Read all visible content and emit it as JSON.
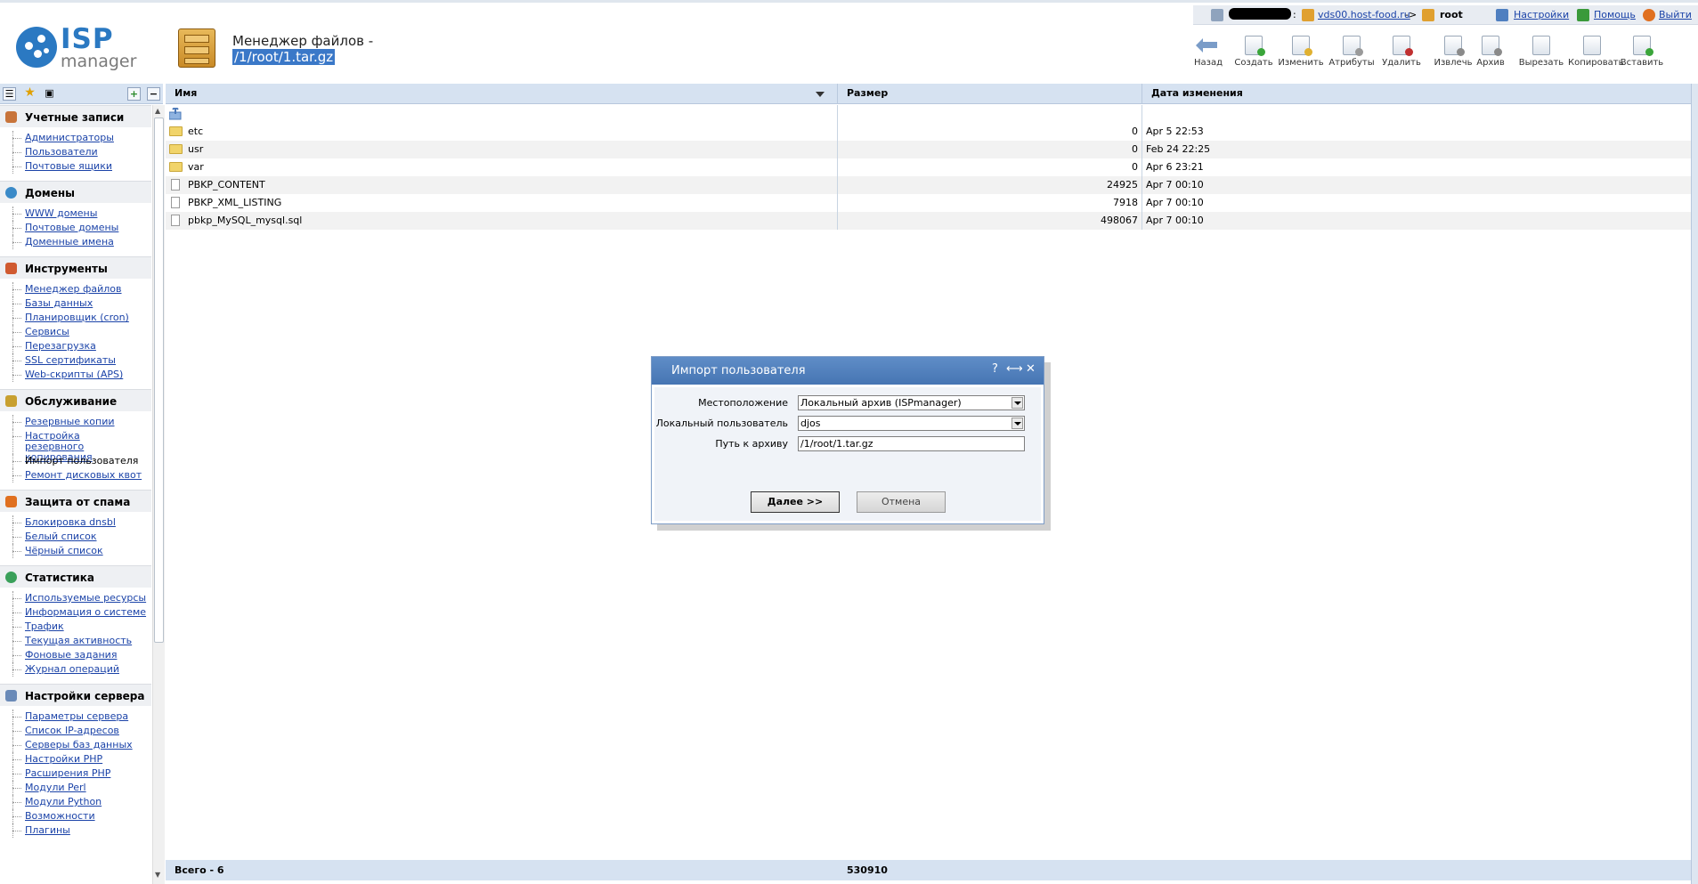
{
  "header": {
    "logo_main": "ISP",
    "logo_sub": "manager",
    "title": "Менеджер файлов -",
    "path": "/1/root/1.tar.gz"
  },
  "userbar": {
    "server_link": "vds00.host-food.ru",
    "arrow": "->",
    "user": "root",
    "settings": "Настройки",
    "help": "Помощь",
    "logout": "Выйти"
  },
  "toolbar": [
    {
      "label": "Назад",
      "icon": "back-arrow-icon"
    },
    {
      "label": "Создать",
      "icon": "create-file-icon"
    },
    {
      "label": "Изменить",
      "icon": "edit-file-icon"
    },
    {
      "label": "Атрибуты",
      "icon": "attributes-icon"
    },
    {
      "label": "Удалить",
      "icon": "delete-icon"
    },
    {
      "label": "Извлечь",
      "icon": "extract-icon"
    },
    {
      "label": "Архив",
      "icon": "archive-icon"
    },
    {
      "label": "Вырезать",
      "icon": "cut-icon"
    },
    {
      "label": "Копировать",
      "icon": "copy-icon"
    },
    {
      "label": "Вставить",
      "icon": "paste-icon"
    }
  ],
  "sidebar": {
    "groups": [
      {
        "title": "Учетные записи",
        "items": [
          "Администраторы",
          "Пользователи",
          "Почтовые ящики"
        ]
      },
      {
        "title": "Домены",
        "items": [
          "WWW домены",
          "Почтовые домены",
          "Доменные имена"
        ]
      },
      {
        "title": "Инструменты",
        "items": [
          "Менеджер файлов",
          "Базы данных",
          "Планировщик (cron)",
          "Сервисы",
          "Перезагрузка",
          "SSL сертификаты",
          "Web-скрипты (APS)"
        ]
      },
      {
        "title": "Обслуживание",
        "items": [
          "Резервные копии",
          "Настройка резервного копирования",
          "Импорт пользователя",
          "Ремонт дисковых квот"
        ]
      },
      {
        "title": "Защита от спама",
        "items": [
          "Блокировка dnsbl",
          "Белый список",
          "Чёрный список"
        ]
      },
      {
        "title": "Статистика",
        "items": [
          "Используемые ресурсы",
          "Информация о системе",
          "Трафик",
          "Текущая активность",
          "Фоновые задания",
          "Журнал операций"
        ]
      },
      {
        "title": "Настройки сервера",
        "items": [
          "Параметры сервера",
          "Список IP-адресов",
          "Серверы баз данных",
          "Настройки PHP",
          "Расширения PHP",
          "Модули Perl",
          "Модули Python",
          "Возможности",
          "Плагины"
        ]
      }
    ]
  },
  "table": {
    "columns": [
      "Имя",
      "Размер",
      "Дата изменения"
    ],
    "rows": [
      {
        "name": "etc",
        "type": "folder",
        "size": "0",
        "date": "Apr 5 22:53"
      },
      {
        "name": "usr",
        "type": "folder",
        "size": "0",
        "date": "Feb 24 22:25"
      },
      {
        "name": "var",
        "type": "folder",
        "size": "0",
        "date": "Apr 6 23:21"
      },
      {
        "name": "PBKP_CONTENT",
        "type": "file",
        "size": "24925",
        "date": "Apr 7 00:10"
      },
      {
        "name": "PBKP_XML_LISTING",
        "type": "file",
        "size": "7918",
        "date": "Apr 7 00:10"
      },
      {
        "name": "pbkp_MySQL_mysql.sql",
        "type": "file",
        "size": "498067",
        "date": "Apr 7 00:10"
      }
    ],
    "footer_total": "Всего - 6",
    "footer_size": "530910"
  },
  "dialog": {
    "title": "Импорт пользователя",
    "help": "?",
    "expand": "⟷",
    "close": "✕",
    "fields": {
      "location_label": "Местоположение",
      "location_value": "Локальный архив (ISPmanager)",
      "user_label": "Локальный пользователь",
      "user_value": "djos",
      "path_label": "Путь к архиву",
      "path_value": "/1/root/1.tar.gz"
    },
    "next_button": "Далее >>",
    "cancel_button": "Отмена"
  },
  "colors": {
    "accent": "#2b79c2",
    "header_blue": "#d6e2f1",
    "dialog_title": "#4f80bd",
    "link": "#1b43a8"
  }
}
